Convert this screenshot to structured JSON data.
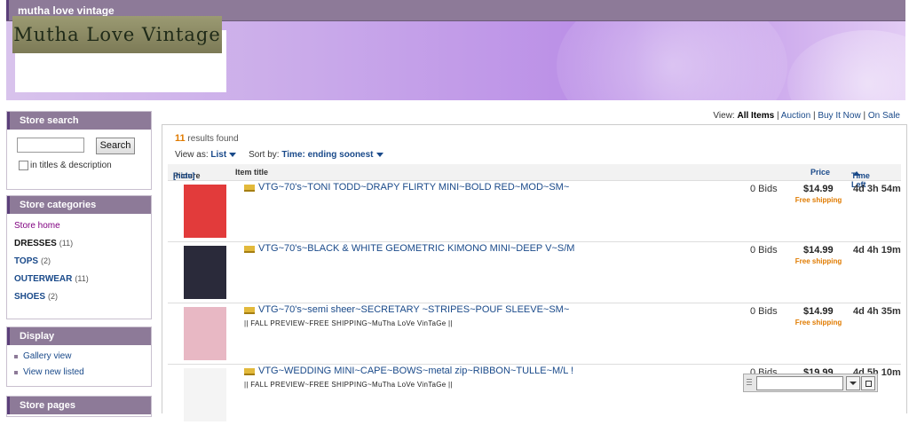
{
  "store": {
    "title": "mutha love vintage",
    "logo_text": "Mutha Love Vintage"
  },
  "sidebar": {
    "search": {
      "heading": "Store search",
      "button": "Search",
      "checkbox_label": "in titles & description"
    },
    "categories": {
      "heading": "Store categories",
      "home": "Store home",
      "items": [
        {
          "label": "DRESSES",
          "count": "(11)"
        },
        {
          "label": "TOPS",
          "count": "(2)"
        },
        {
          "label": "OUTERWEAR",
          "count": "(11)"
        },
        {
          "label": "SHOES",
          "count": "(2)"
        }
      ]
    },
    "display": {
      "heading": "Display",
      "gallery": "Gallery view",
      "new_listed": "View new listed"
    },
    "pages": {
      "heading": "Store pages"
    }
  },
  "view_bar": {
    "prefix": "View:",
    "all": "All Items",
    "auction": "Auction",
    "buy": "Buy It Now",
    "sale": "On Sale",
    "sep": "|"
  },
  "results": {
    "count": "11",
    "count_text": "results found",
    "view_as_label": "View as:",
    "view_as_value": "List",
    "sort_label": "Sort by:",
    "sort_value": "Time: ending soonest"
  },
  "columns": {
    "picture": "Picture",
    "hide": "[hide]",
    "title": "Item title",
    "price": "Price",
    "time": "Time Left"
  },
  "items": [
    {
      "title": "VTG~70's~TONI TODD~DRAPY FLIRTY MINI~BOLD RED~MOD~SM~",
      "subtitle": "",
      "bids": "0 Bids",
      "price": "$14.99",
      "shipping": "Free shipping",
      "time": "4d 3h 54m",
      "thumb_color": "#e23b3b"
    },
    {
      "title": "VTG~70's~BLACK & WHITE GEOMETRIC KIMONO MINI~DEEP V~S/M",
      "subtitle": "",
      "bids": "0 Bids",
      "price": "$14.99",
      "shipping": "Free shipping",
      "time": "4d 4h 19m",
      "thumb_color": "#2a2a3a"
    },
    {
      "title": "VTG~70's~semi sheer~SECRETARY ~STRIPES~POUF SLEEVE~SM~",
      "subtitle": "|| FALL PREVIEW~FREE SHIPPING~MuTha LoVe VinTaGe ||",
      "bids": "0 Bids",
      "price": "$14.99",
      "shipping": "Free shipping",
      "time": "4d 4h 35m",
      "thumb_color": "#e8b8c4"
    },
    {
      "title": "VTG~WEDDING MINI~CAPE~BOWS~metal zip~RIBBON~TULLE~M/L !",
      "subtitle": "|| FALL PREVIEW~FREE SHIPPING~MuTha LoVe VinTaGe ||",
      "bids": "0 Bids",
      "price": "$19.99",
      "shipping": "",
      "time": "4d 5h 10m",
      "thumb_color": "#f4f4f4"
    }
  ]
}
